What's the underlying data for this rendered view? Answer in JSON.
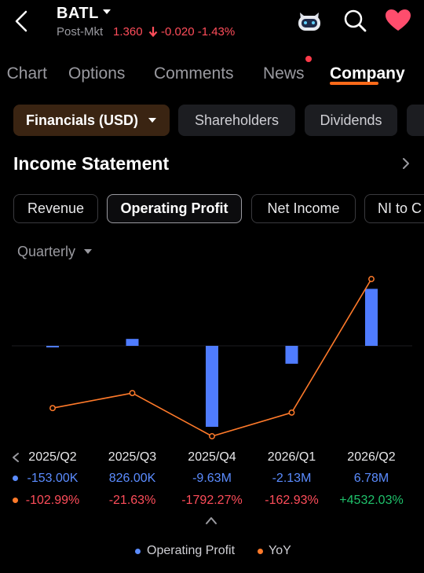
{
  "header": {
    "ticker": "BATL",
    "post_market_label": "Post-Mkt",
    "price": "1.360",
    "change": "-0.020 -1.43%"
  },
  "tabs": [
    {
      "label": "Chart"
    },
    {
      "label": "Options"
    },
    {
      "label": "Comments"
    },
    {
      "label": "News"
    },
    {
      "label": "Company"
    }
  ],
  "sub_tabs": [
    {
      "label": "Financials (USD)"
    },
    {
      "label": "Shareholders"
    },
    {
      "label": "Dividends"
    }
  ],
  "section": {
    "title": "Income Statement"
  },
  "metric_tabs": [
    {
      "label": "Revenue"
    },
    {
      "label": "Operating Profit"
    },
    {
      "label": "Net Income"
    },
    {
      "label": "NI to C"
    }
  ],
  "period": {
    "selected": "Quarterly"
  },
  "colors": {
    "bar": "#4f7cff",
    "line": "#ff7a2a",
    "accent": "#ff6a1a",
    "negative": "#ff4d5a",
    "positive": "#1fc16b"
  },
  "chart_data": {
    "type": "bar",
    "categories": [
      "2025/Q2",
      "2025/Q3",
      "2025/Q4",
      "2026/Q1",
      "2026/Q2"
    ],
    "series": [
      {
        "name": "Operating Profit",
        "type": "bar",
        "values": [
          -153000,
          826000,
          -9630000,
          -2130000,
          6780000
        ],
        "display": [
          "-153.00K",
          "826.00K",
          "-9.63M",
          "-2.13M",
          "6.78M"
        ]
      },
      {
        "name": "YoY",
        "type": "line",
        "values": [
          -102.99,
          -21.63,
          -1792.27,
          -162.93,
          4532.03
        ],
        "display": [
          "-102.99%",
          "-21.63%",
          "-1792.27%",
          "-162.93%",
          "+4532.03%"
        ]
      }
    ],
    "legend": "bottom"
  }
}
